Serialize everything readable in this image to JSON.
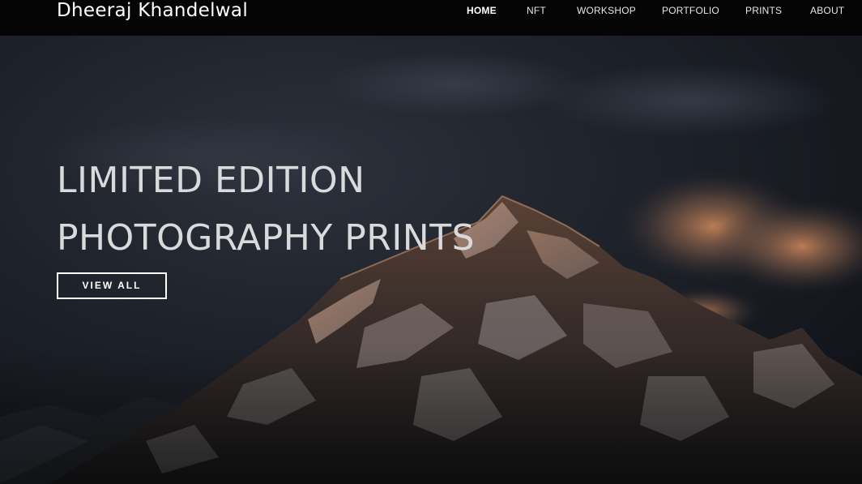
{
  "brand": {
    "name": "Dheeraj Khandelwal"
  },
  "nav": {
    "items": [
      {
        "label": "HOME",
        "active": true
      },
      {
        "label": "NFT",
        "active": false
      },
      {
        "label": "WORKSHOP",
        "active": false
      },
      {
        "label": "PORTFOLIO",
        "active": false
      },
      {
        "label": "PRINTS",
        "active": false
      },
      {
        "label": "ABOUT",
        "active": false
      }
    ]
  },
  "hero": {
    "headline_line1": "LIMITED EDITION",
    "headline_line2": "PHOTOGRAPHY PRINTS",
    "cta_label": "VIEW ALL",
    "background": "snow-capped mountain peak at dusk with warm lit clouds"
  },
  "colors": {
    "topbar": "#050505",
    "sky_dark": "#15181f",
    "sky_mid": "#2a2f3a",
    "alpenglow": "#c8865a",
    "headline": "#d9dadb",
    "button_border": "#ffffff"
  }
}
